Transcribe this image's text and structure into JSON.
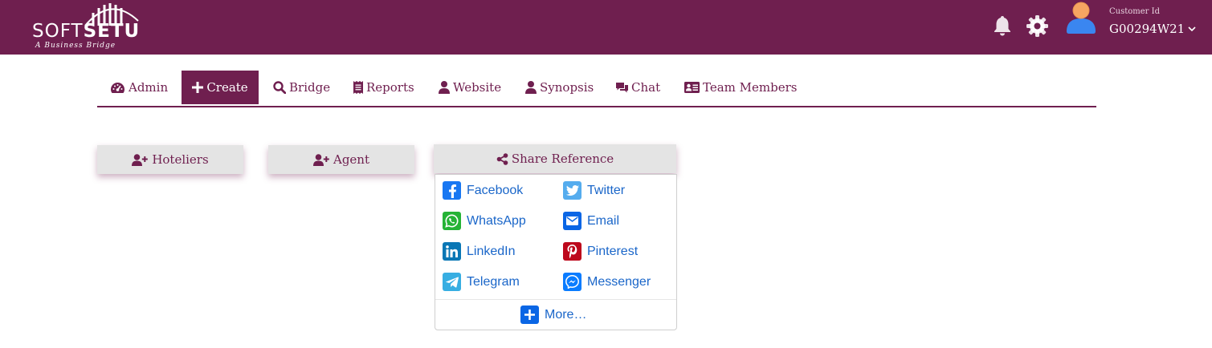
{
  "header": {
    "logo_word_1": "SOFT",
    "logo_word_2": "SETU",
    "logo_tagline": "A Business Bridge",
    "customer_label": "Customer Id",
    "customer_id": "G00294W21"
  },
  "tabs": [
    {
      "label": "Admin",
      "icon": "dashboard-icon",
      "active": false
    },
    {
      "label": "Create",
      "icon": "plus-icon",
      "active": true
    },
    {
      "label": "Bridge",
      "icon": "search-icon",
      "active": false
    },
    {
      "label": "Reports",
      "icon": "receipt-icon",
      "active": false
    },
    {
      "label": "Website",
      "icon": "user-icon",
      "active": false
    },
    {
      "label": "Synopsis",
      "icon": "user-icon",
      "active": false
    },
    {
      "label": "Chat",
      "icon": "chat-icon",
      "active": false
    },
    {
      "label": "Team Members",
      "icon": "id-card-icon",
      "active": false
    }
  ],
  "actions": {
    "hoteliers": "Hoteliers",
    "agent": "Agent",
    "share_reference": "Share Reference"
  },
  "share_menu": {
    "items": [
      {
        "label": "Facebook",
        "icon": "facebook-icon"
      },
      {
        "label": "Twitter",
        "icon": "twitter-icon"
      },
      {
        "label": "WhatsApp",
        "icon": "whatsapp-icon"
      },
      {
        "label": "Email",
        "icon": "email-icon"
      },
      {
        "label": "LinkedIn",
        "icon": "linkedin-icon"
      },
      {
        "label": "Pinterest",
        "icon": "pinterest-icon"
      },
      {
        "label": "Telegram",
        "icon": "telegram-icon"
      },
      {
        "label": "Messenger",
        "icon": "messenger-icon"
      }
    ],
    "more": "More…"
  },
  "colors": {
    "brand": "#6f1f4f",
    "button_bg": "#e4e4e4",
    "link": "#1a66c9",
    "facebook": "#1877f2",
    "twitter": "#55acee",
    "whatsapp": "#25b336",
    "email": "#0a66e5",
    "linkedin": "#0a77b5",
    "pinterest": "#bd081c",
    "telegram": "#37aee2",
    "messenger": "#0a7cff"
  }
}
